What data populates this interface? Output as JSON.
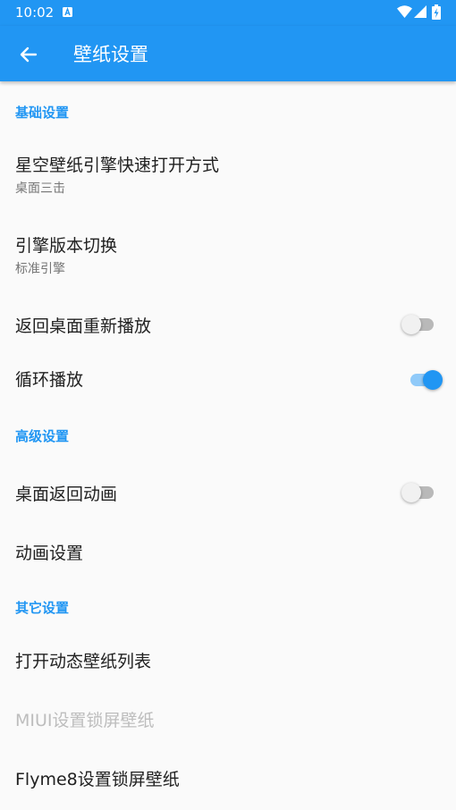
{
  "status_bar": {
    "time": "10:02",
    "notification_icon": "a-square-icon",
    "wifi_icon": "wifi-icon",
    "signal_icon": "signal-icon",
    "battery_icon": "battery-charging-icon",
    "color": "#2196f3"
  },
  "app_bar": {
    "title": "壁纸设置",
    "back_icon": "arrow-left-icon",
    "color": "#2196f3"
  },
  "sections": {
    "basic": {
      "header": "基础设置",
      "items": {
        "open_method": {
          "title": "星空壁纸引擎快速打开方式",
          "summary": "桌面三击"
        },
        "engine_switch": {
          "title": "引擎版本切换",
          "summary": "标准引擎"
        },
        "replay_on_home": {
          "title": "返回桌面重新播放",
          "toggle": false
        },
        "loop": {
          "title": "循环播放",
          "toggle": true
        }
      }
    },
    "advanced": {
      "header": "高级设置",
      "items": {
        "home_anim": {
          "title": "桌面返回动画",
          "toggle": false
        },
        "anim_settings": {
          "title": "动画设置"
        }
      }
    },
    "other": {
      "header": "其它设置",
      "items": {
        "wallpaper_list": {
          "title": "打开动态壁纸列表"
        },
        "miui_lock": {
          "title": "MIUI设置锁屏壁纸",
          "disabled": true
        },
        "flyme_lock": {
          "title": "Flyme8设置锁屏壁纸"
        }
      }
    }
  },
  "colors": {
    "accent": "#2196f3",
    "text_primary": "#212121",
    "text_secondary": "#757575",
    "text_disabled": "#bdbdbd",
    "background": "#fafafa"
  }
}
